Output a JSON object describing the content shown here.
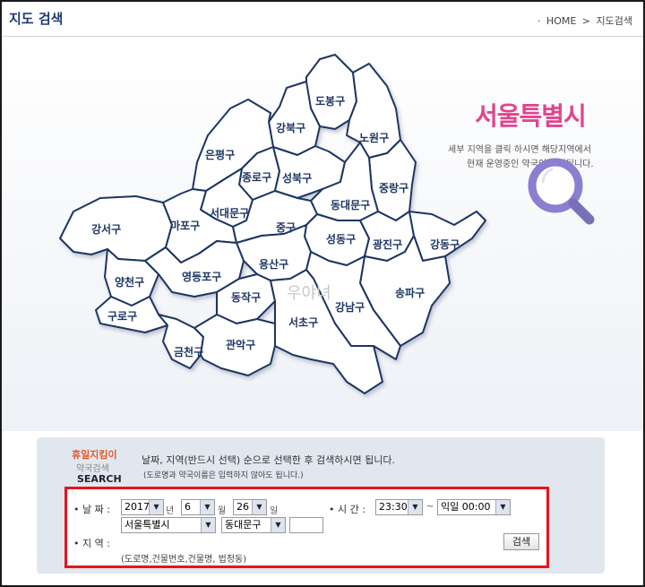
{
  "header": {
    "title": "지도 검색",
    "breadcrumb": [
      "HOME",
      "지도검색"
    ]
  },
  "map": {
    "watermark": "우야녀",
    "districts": [
      {
        "id": "dobong",
        "name": "도봉구"
      },
      {
        "id": "gangbuk",
        "name": "강북구"
      },
      {
        "id": "nowon",
        "name": "노원구"
      },
      {
        "id": "eunpyeong",
        "name": "은평구"
      },
      {
        "id": "jongno",
        "name": "종로구"
      },
      {
        "id": "seongbuk",
        "name": "성북구"
      },
      {
        "id": "jungnang",
        "name": "중랑구"
      },
      {
        "id": "seodaemun",
        "name": "서대문구"
      },
      {
        "id": "dongdaemun",
        "name": "동대문구"
      },
      {
        "id": "gangseo",
        "name": "강서구"
      },
      {
        "id": "mapo",
        "name": "마포구"
      },
      {
        "id": "jung",
        "name": "중구"
      },
      {
        "id": "seongdong",
        "name": "성동구"
      },
      {
        "id": "gwangjin",
        "name": "광진구"
      },
      {
        "id": "gangdong",
        "name": "강동구"
      },
      {
        "id": "yangcheon",
        "name": "양천구"
      },
      {
        "id": "yongsan",
        "name": "용산구"
      },
      {
        "id": "yeongdeungpo",
        "name": "영등포구"
      },
      {
        "id": "songpa",
        "name": "송파구"
      },
      {
        "id": "guro",
        "name": "구로구"
      },
      {
        "id": "dongjak",
        "name": "동작구"
      },
      {
        "id": "gangnam",
        "name": "강남구"
      },
      {
        "id": "seocho",
        "name": "서초구"
      },
      {
        "id": "geumcheon",
        "name": "금천구"
      },
      {
        "id": "gwanak",
        "name": "관악구"
      }
    ]
  },
  "city": {
    "title": "서울특별시",
    "desc_line1": "세부 지역을 클릭 하시면 해당지역에서",
    "desc_line2": "현재 운영중인 약국이 검색됩니다.",
    "magnifier_icon": "magnifier-icon"
  },
  "panel": {
    "logo_line1": "휴일지킴이",
    "logo_line2": "약국검색",
    "logo_line3": "SEARCH",
    "instruction": "날짜, 지역(반드시 선택) 순으로 선택한 후 검색하시면 됩니다.",
    "note": "(도로명과 약국이름은 입력하지 않아도 됩니다.)"
  },
  "form": {
    "date_label": "• 날 짜 :",
    "year": "2017",
    "year_unit": "년",
    "month": "6",
    "month_unit": "월",
    "day": "26",
    "day_unit": "일",
    "time_label": "• 시 간 :",
    "time_from": "23:30",
    "time_sep": "~",
    "time_to": "익일 00:00",
    "region_label": "• 지 역 :",
    "city": "서울특별시",
    "district": "동대문구",
    "keyword": "",
    "search_label": "검색",
    "hint": "(도로명,건물번호,건물명, 법정동)"
  },
  "colors": {
    "accent": "#e0458c",
    "map_stroke": "#1e3563",
    "highlight_border": "#e8131e",
    "panel_bg": "#e1e7ef"
  }
}
